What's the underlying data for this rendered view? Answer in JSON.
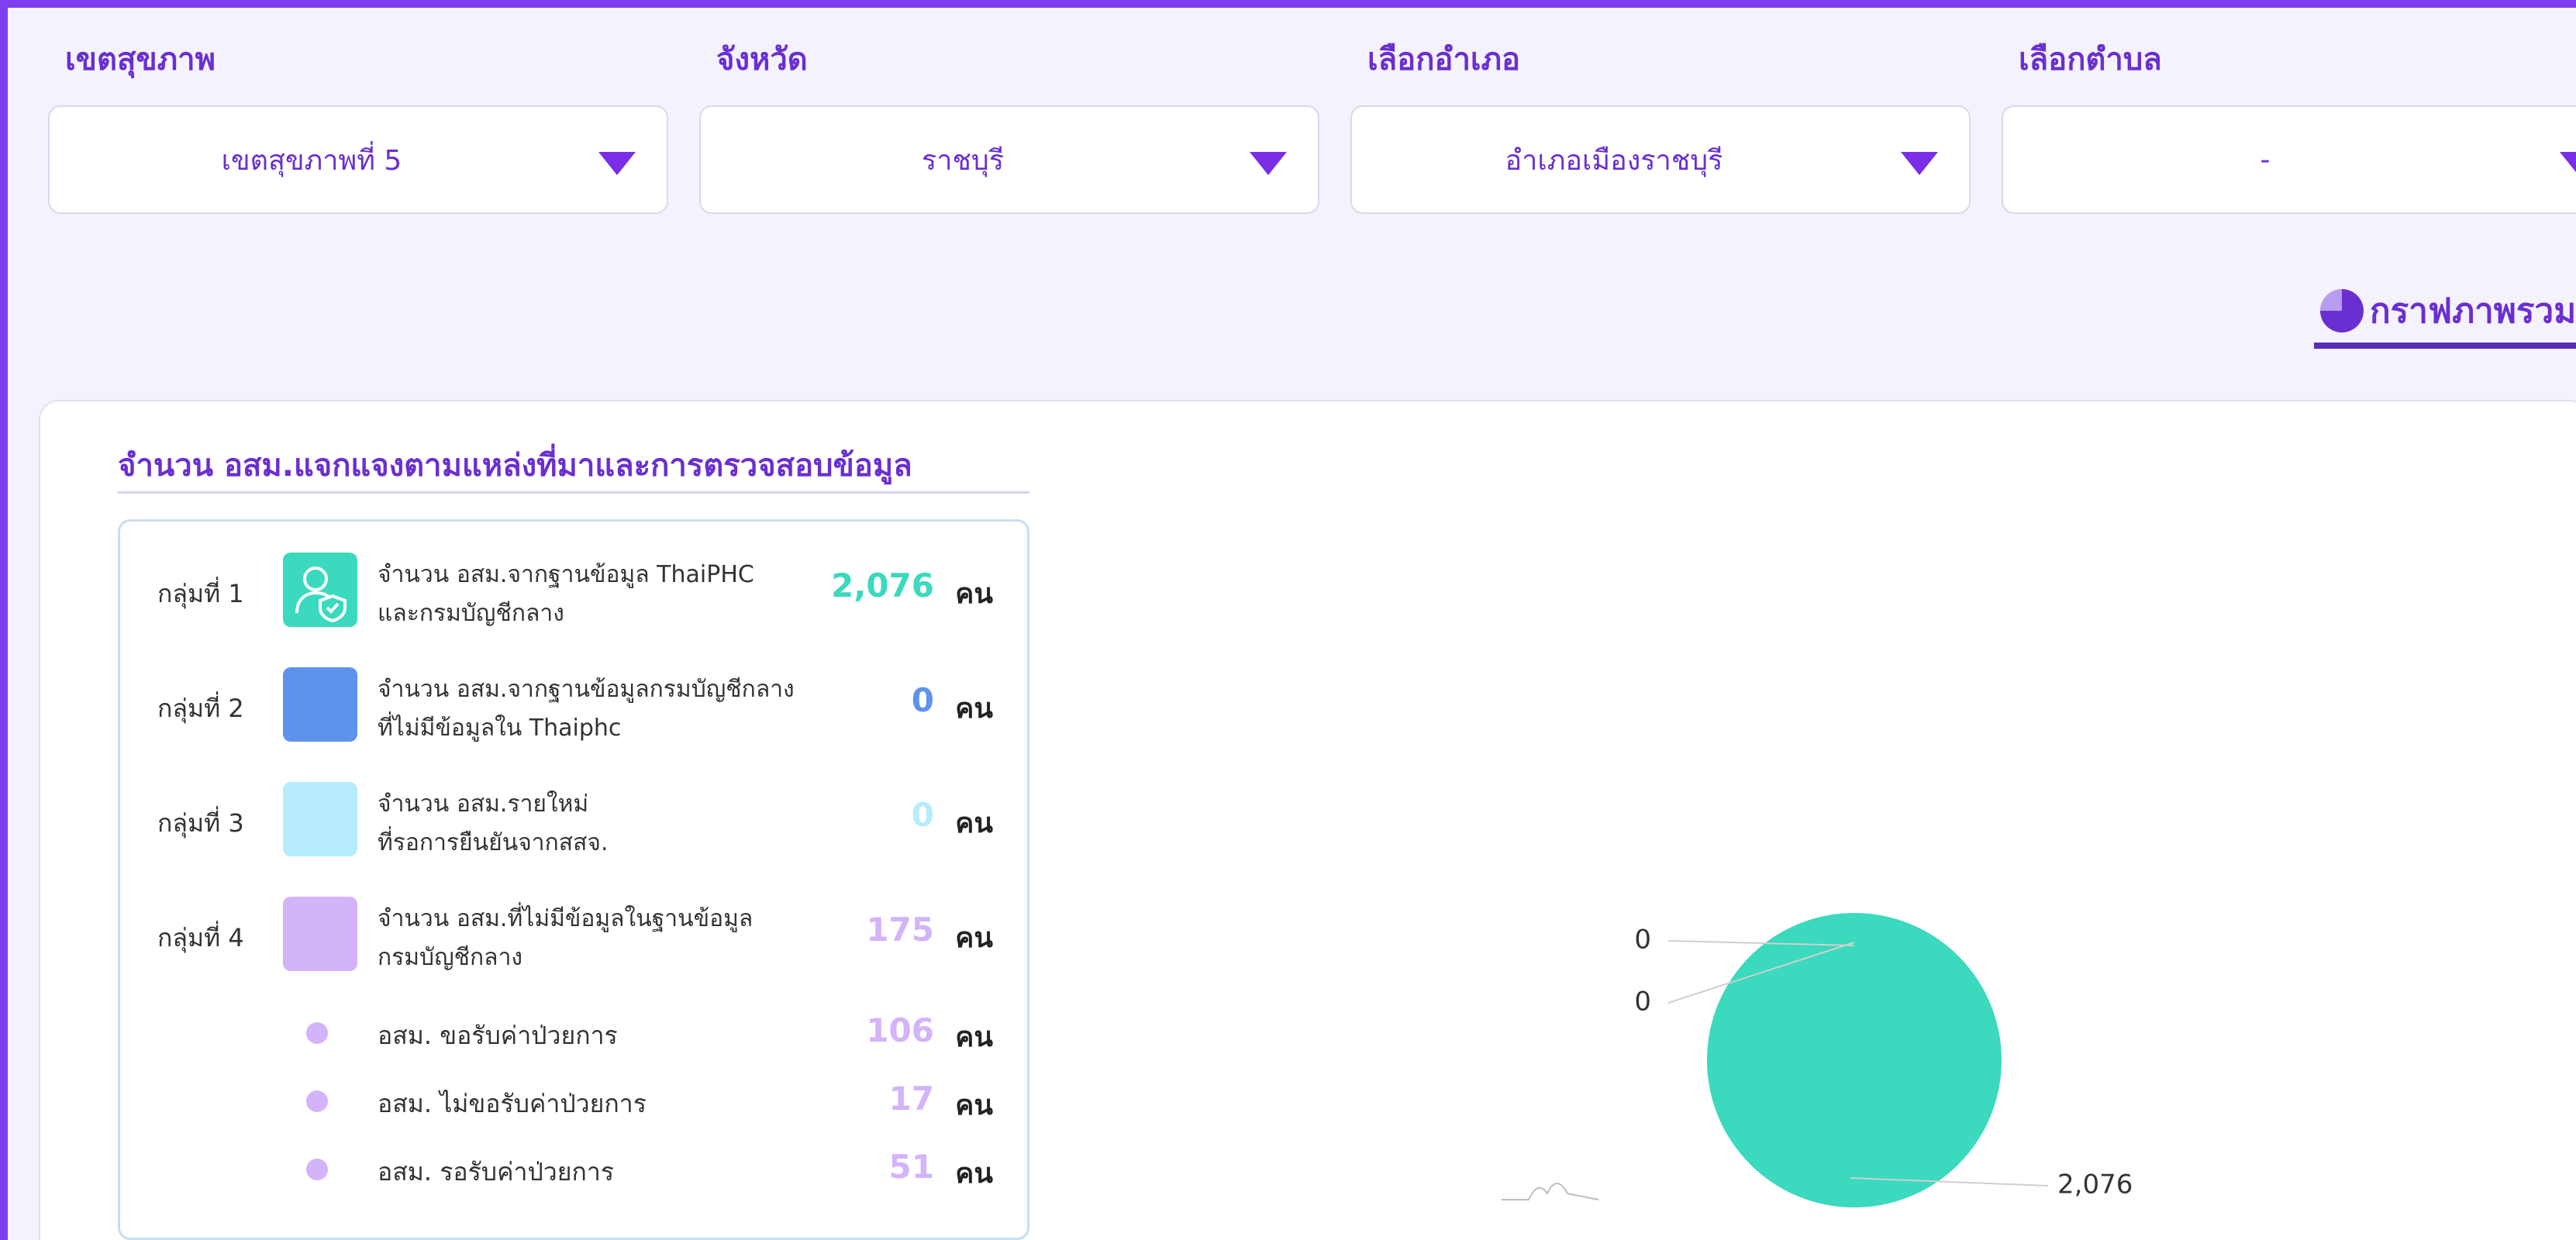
{
  "filters": [
    {
      "label": "เขตสุขภาพ",
      "value": "เขตสุขภาพที่ 5"
    },
    {
      "label": "จังหวัด",
      "value": "ราชบุรี"
    },
    {
      "label": "เลือกอำเภอ",
      "value": "อำเภอเมืองราชบุรี"
    },
    {
      "label": "เลือกตำบล",
      "value": "-"
    }
  ],
  "tab": {
    "label": "กราฟภาพรวม"
  },
  "card": {
    "title": "จำนวน อสม.แจกแจงตามแหล่งที่มาและการตรวจสอบข้อมูล",
    "unit": "คน",
    "groups": [
      {
        "group": "กลุ่มที่ 1",
        "line1": "จำนวน อสม.จากฐานข้อมูล ThaiPHC",
        "line2": "และกรมบัญชีกลาง",
        "count": "2,076",
        "color": "#3bd9bd",
        "icon": "user-shield-icon"
      },
      {
        "group": "กลุ่มที่ 2",
        "line1": "จำนวน อสม.จากฐานข้อมูลกรมบัญชีกลาง",
        "line2": "ที่ไม่มีข้อมูลใน Thaiphc",
        "count": "0",
        "color": "#5f92ee"
      },
      {
        "group": "กลุ่มที่ 3",
        "line1": "จำนวน อสม.รายใหม่",
        "line2": "ที่รอการยืนยันจากสสจ.",
        "count": "0",
        "color": "#b6ecfb"
      },
      {
        "group": "กลุ่มที่ 4",
        "line1": "จำนวน อสม.ที่ไม่มีข้อมูลในฐานข้อมูล",
        "line2": "กรมบัญชีกลาง",
        "count": "175",
        "color": "#d3b3f9"
      }
    ],
    "subitems": [
      {
        "label": "อสม. ขอรับค่าป่วยการ",
        "count": "106"
      },
      {
        "label": "อสม. ไม่ขอรับค่าป่วยการ",
        "count": "17"
      },
      {
        "label": "อสม. รอรับค่าป่วยการ",
        "count": "51"
      }
    ]
  },
  "chart_data": {
    "type": "pie",
    "categories": [
      "กลุ่มที่ 1",
      "กลุ่มที่ 2",
      "กลุ่มที่ 3",
      "กลุ่มที่ 4"
    ],
    "values": [
      2076,
      0,
      0,
      0
    ],
    "data_labels": [
      "2,076",
      "0",
      "0",
      ""
    ],
    "colors": [
      "#3bd9bd",
      "#5f92ee",
      "#b6ecfb",
      "#d3b3f9"
    ]
  }
}
